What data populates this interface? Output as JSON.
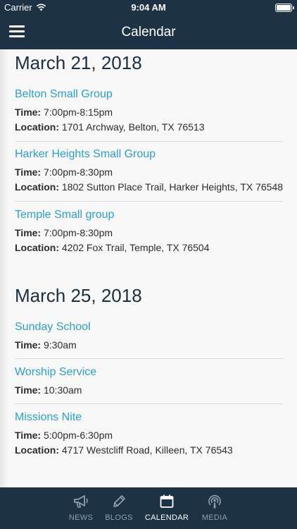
{
  "status": {
    "carrier": "Carrier",
    "time": "9:04 AM"
  },
  "header": {
    "title": "Calendar"
  },
  "days": [
    {
      "date": "March 21, 2018",
      "events": [
        {
          "title": "Belton Small Group",
          "time_label": "Time:",
          "time": "7:00pm-8:15pm",
          "location_label": "Location:",
          "location": "1701 Archway, Belton, TX 76513"
        },
        {
          "title": "Harker Heights Small Group",
          "time_label": "Time:",
          "time": "7:00pm-8:30pm",
          "location_label": "Location:",
          "location": "1802 Sutton Place Trail, Harker Heights, TX 76548"
        },
        {
          "title": "Temple Small group",
          "time_label": "Time:",
          "time": "7:00pm-8:30pm",
          "location_label": "Location:",
          "location": "4202 Fox Trail, Temple, TX 76504"
        }
      ]
    },
    {
      "date": "March 25, 2018",
      "events": [
        {
          "title": "Sunday School",
          "time_label": "Time:",
          "time": "9:30am"
        },
        {
          "title": "Worship Service",
          "time_label": "Time:",
          "time": "10:30am"
        },
        {
          "title": "Missions Nite",
          "time_label": "Time:",
          "time": "5:00pm-6:30pm",
          "location_label": "Location:",
          "location": "4717 Westcliff Road, Killeen, TX 76543"
        }
      ]
    }
  ],
  "tabs": [
    {
      "label": "NEWS",
      "icon": "megaphone-icon",
      "active": false
    },
    {
      "label": "BLOGS",
      "icon": "pencil-icon",
      "active": false
    },
    {
      "label": "CALENDAR",
      "icon": "calendar-icon",
      "active": true
    },
    {
      "label": "MEDIA",
      "icon": "podcast-icon",
      "active": false
    }
  ],
  "colors": {
    "bar": "#1d3244",
    "link": "#2a9fd6",
    "heading": "#1d2f3f",
    "tab_inactive": "#8fa0ae"
  }
}
